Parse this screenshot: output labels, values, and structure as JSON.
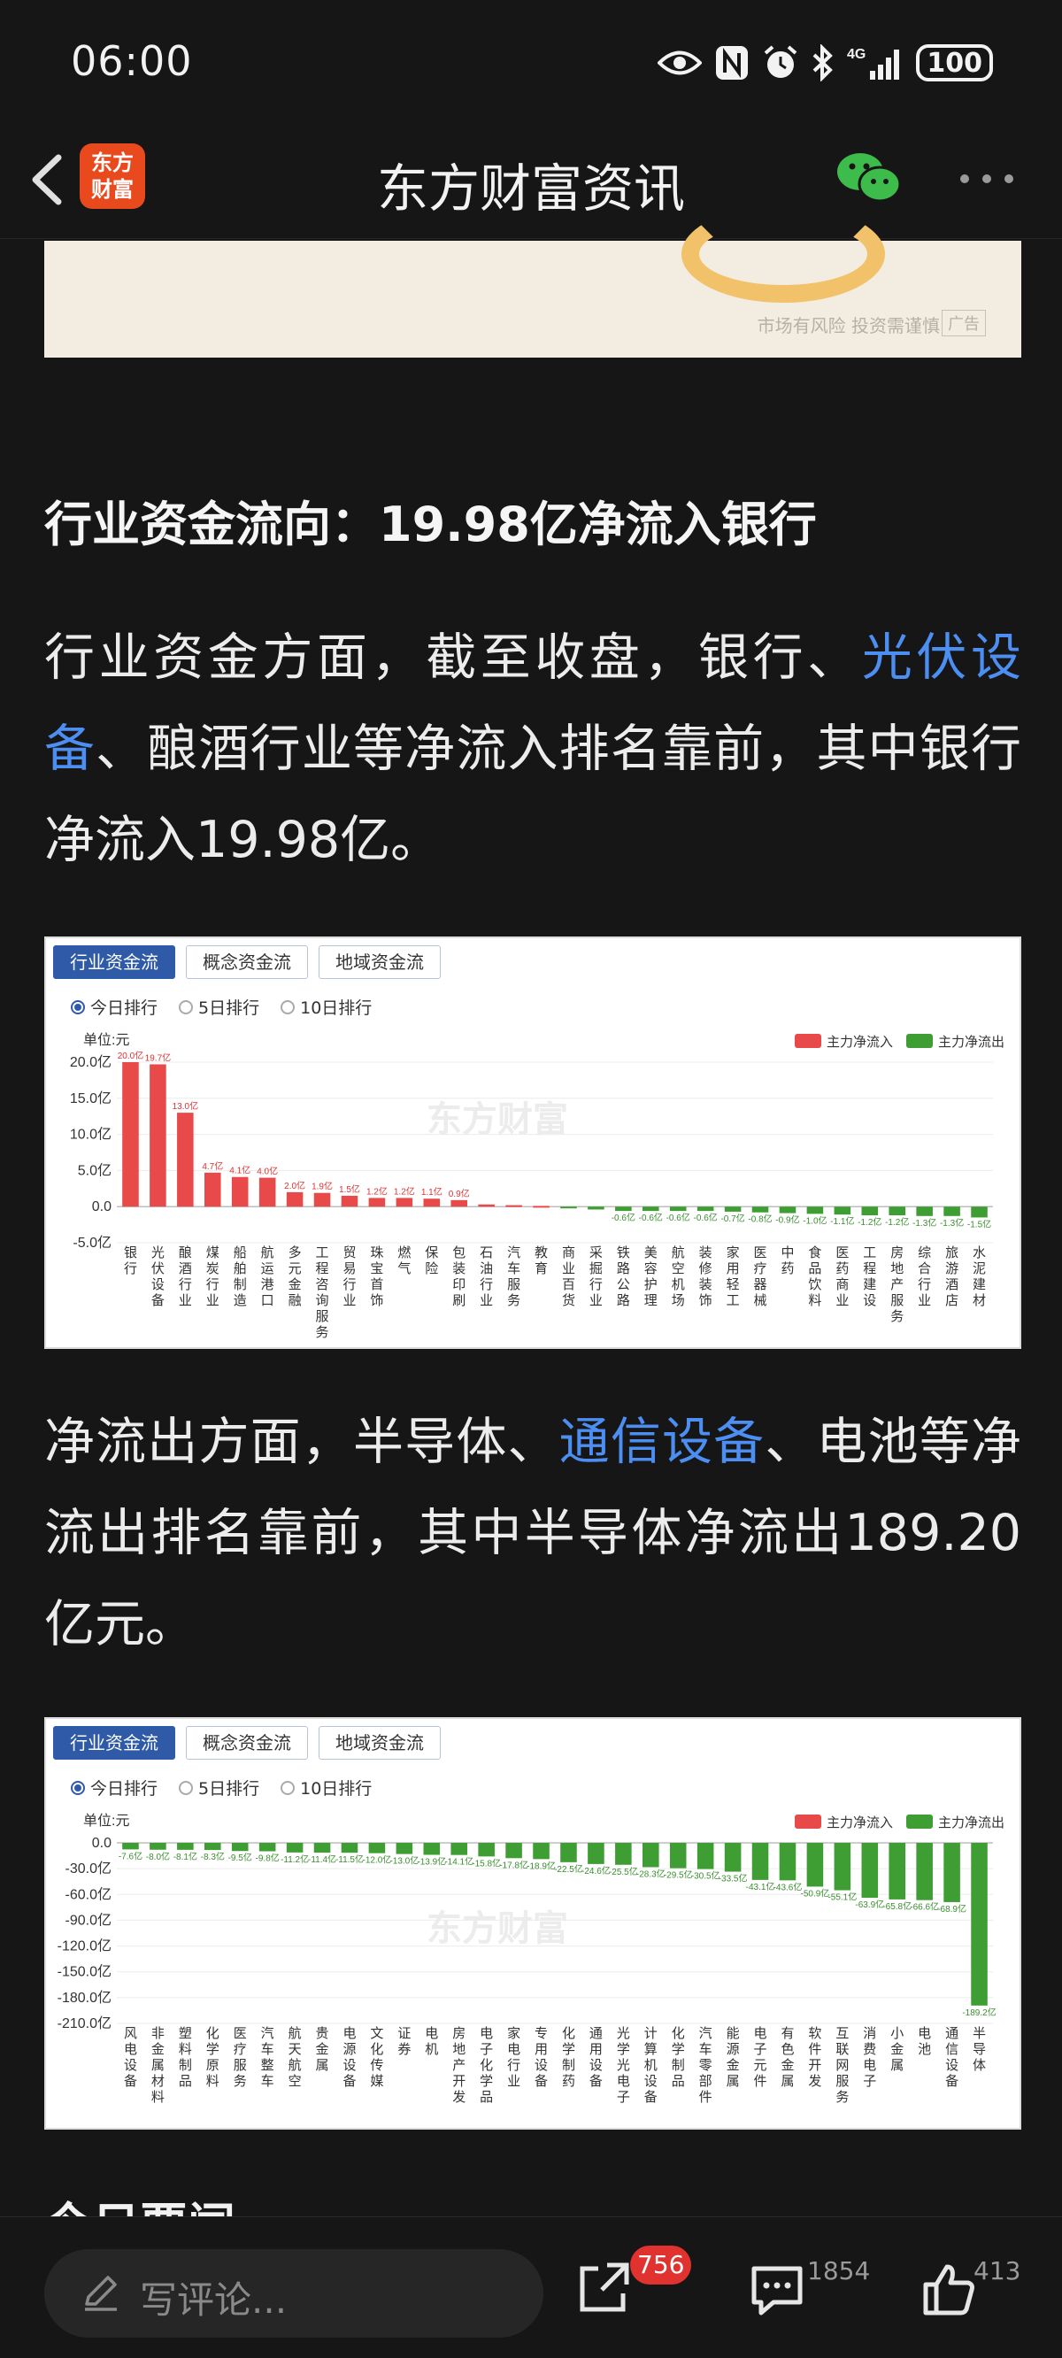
{
  "status_bar": {
    "time": "06:00",
    "network": "4G",
    "battery": "100"
  },
  "header": {
    "logo_line1": "东方",
    "logo_line2": "财富",
    "title": "东方财富资讯"
  },
  "ad": {
    "note": "市场有风险 投资需谨慎",
    "badge": "广告"
  },
  "article": {
    "section_heading": "行业资金流向：19.98亿净流入银行",
    "para1_a": "行业资金方面，截至收盘，银行、",
    "para1_link": "光伏设备",
    "para1_b": "、酿酒行业等净流入排名靠前，其中银行净流入19.98亿。",
    "para2_a": "净流出方面，半导体、",
    "para2_link": "通信设备",
    "para2_b": "、电池等净流出排名靠前，其中半导体净流出189.20亿元。",
    "next_heading": "今日要闻"
  },
  "chart_widget": {
    "tabs": [
      "行业资金流",
      "概念资金流",
      "地域资金流"
    ],
    "radios": [
      "今日排行",
      "5日排行",
      "10日排行"
    ],
    "selected_radio": "今日排行",
    "unit_label": "单位:元",
    "legend_in": "主力净流入",
    "legend_out": "主力净流出",
    "watermark": "东方财富",
    "color_in": "#e84a4a",
    "color_out": "#3f9e33"
  },
  "chart_data": [
    {
      "type": "bar",
      "ylabel": "单位:元",
      "ylim": [
        -5,
        20
      ],
      "yticks": [
        "20.0亿",
        "15.0亿",
        "10.0亿",
        "5.0亿",
        "0.0",
        "-5.0亿"
      ],
      "ytick_values": [
        20,
        15,
        10,
        5,
        0,
        -5
      ],
      "categories": [
        "银行",
        "光伏设备",
        "酿酒行业",
        "煤炭行业",
        "船舶制造",
        "航运港口",
        "多元金融",
        "工程咨询服务",
        "贸易行业",
        "珠宝首饰",
        "燃气",
        "保险",
        "包装印刷",
        "石油行业",
        "汽车服务",
        "教育",
        "商业百货",
        "采掘行业",
        "铁路公路",
        "美容护理",
        "航空机场",
        "装修装饰",
        "家用轻工",
        "医疗器械",
        "中药",
        "食品饮料",
        "医药商业",
        "工程建设",
        "房地产服务",
        "综合行业",
        "旅游酒店",
        "水泥建材"
      ],
      "values": [
        20.0,
        19.7,
        13.0,
        4.7,
        4.1,
        4.0,
        2.0,
        1.9,
        1.5,
        1.2,
        1.2,
        1.1,
        0.9,
        0.3,
        0.2,
        0.1,
        -0.2,
        -0.4,
        -0.6,
        -0.6,
        -0.6,
        -0.6,
        -0.7,
        -0.8,
        -0.9,
        -1.0,
        -1.1,
        -1.2,
        -1.2,
        -1.3,
        -1.3,
        -1.5
      ],
      "value_labels": [
        "20.0亿",
        "19.7亿",
        "13.0亿",
        "4.7亿",
        "4.1亿",
        "4.0亿",
        "2.0亿",
        "1.9亿",
        "1.5亿",
        "1.2亿",
        "1.2亿",
        "1.1亿",
        "0.9亿",
        "",
        "",
        "",
        "",
        "",
        "-0.6亿",
        "-0.6亿",
        "-0.6亿",
        "-0.6亿",
        "-0.7亿",
        "-0.8亿",
        "-0.9亿",
        "-1.0亿",
        "-1.1亿",
        "-1.2亿",
        "-1.2亿",
        "-1.3亿",
        "-1.3亿",
        "-1.5亿"
      ]
    },
    {
      "type": "bar",
      "ylabel": "单位:元",
      "ylim": [
        -210,
        0
      ],
      "yticks": [
        "0.0",
        "-30.0亿",
        "-60.0亿",
        "-90.0亿",
        "-120.0亿",
        "-150.0亿",
        "-180.0亿",
        "-210.0亿"
      ],
      "ytick_values": [
        0,
        -30,
        -60,
        -90,
        -120,
        -150,
        -180,
        -210
      ],
      "categories": [
        "风电设备",
        "非金属材料",
        "塑料制品",
        "化学原料",
        "医疗服务",
        "汽车整车",
        "航天航空",
        "贵金属",
        "电源设备",
        "文化传媒",
        "证券",
        "电机",
        "房地产开发",
        "电子化学品",
        "家电行业",
        "专用设备",
        "化学制药",
        "通用设备",
        "光学光电子",
        "计算机设备",
        "化学制品",
        "汽车零部件",
        "能源金属",
        "电子元件",
        "有色金属",
        "软件开发",
        "互联网服务",
        "消费电子",
        "小金属",
        "电池",
        "通信设备",
        "半导体"
      ],
      "values": [
        -7.6,
        -8.0,
        -8.1,
        -8.3,
        -9.5,
        -9.8,
        -11.2,
        -11.4,
        -11.5,
        -12.0,
        -13.0,
        -13.9,
        -14.1,
        -15.8,
        -17.8,
        -18.9,
        -22.5,
        -24.6,
        -25.5,
        -28.3,
        -29.5,
        -30.5,
        -33.5,
        -43.1,
        -43.6,
        -50.9,
        -55.1,
        -63.9,
        -65.8,
        -66.6,
        -68.9,
        -189.2
      ],
      "value_labels": [
        "-7.6亿",
        "-8.0亿",
        "-8.1亿",
        "-8.3亿",
        "-9.5亿",
        "-9.8亿",
        "-11.2亿",
        "-11.4亿",
        "-11.5亿",
        "-12.0亿",
        "-13.0亿",
        "-13.9亿",
        "-14.1亿",
        "-15.8亿",
        "-17.8亿",
        "-18.9亿",
        "-22.5亿",
        "-24.6亿",
        "-25.5亿",
        "-28.3亿",
        "-29.5亿",
        "-30.5亿",
        "-33.5亿",
        "-43.1亿",
        "-43.6亿",
        "-50.9亿",
        "-55.1亿",
        "-63.9亿",
        "-65.8亿",
        "-66.6亿",
        "-68.9亿",
        "-189.2亿"
      ]
    }
  ],
  "bottom_bar": {
    "comment_placeholder": "写评论...",
    "share_count": "756",
    "comment_count": "1854",
    "like_count": "413"
  }
}
